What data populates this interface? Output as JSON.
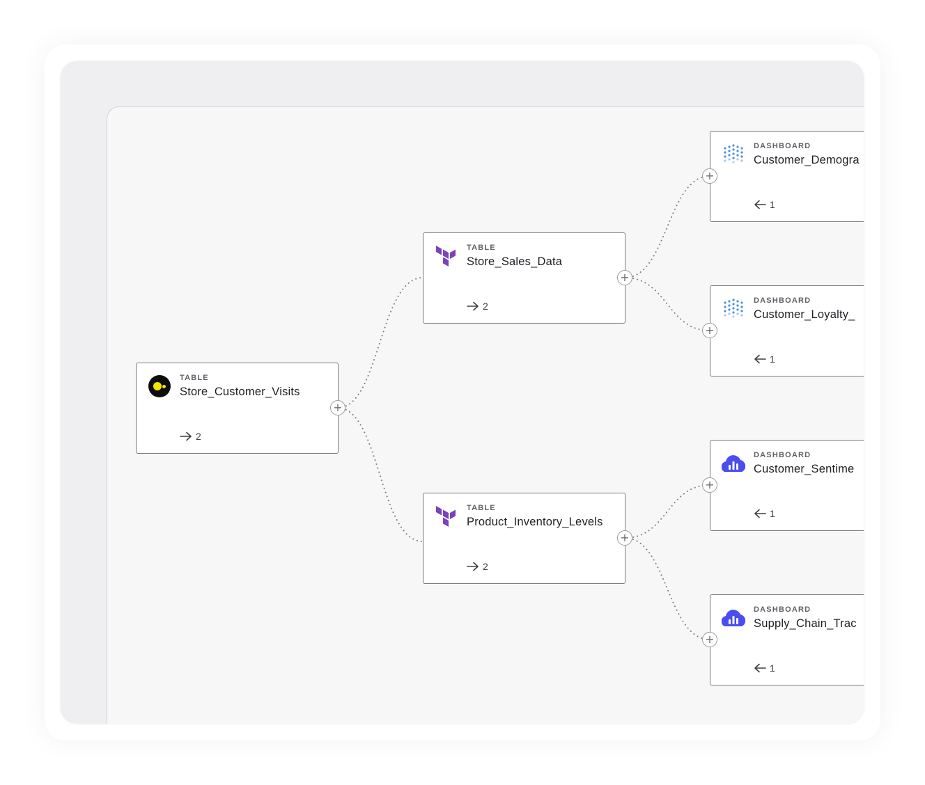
{
  "nodes": {
    "store_customer_visits": {
      "type": "TABLE",
      "name": "Store_Customer_Visits",
      "count": "2"
    },
    "store_sales_data": {
      "type": "TABLE",
      "name": "Store_Sales_Data",
      "count": "2"
    },
    "product_inventory_levels": {
      "type": "TABLE",
      "name": "Product_Inventory_Levels",
      "count": "2"
    },
    "customer_demographics": {
      "type": "DASHBOARD",
      "name": "Customer_Demogra",
      "count": "1"
    },
    "customer_loyalty": {
      "type": "DASHBOARD",
      "name": "Customer_Loyalty_",
      "count": "1"
    },
    "customer_sentiment": {
      "type": "DASHBOARD",
      "name": "Customer_Sentime",
      "count": "1"
    },
    "supply_chain": {
      "type": "DASHBOARD",
      "name": "Supply_Chain_Trac",
      "count": "1"
    }
  },
  "edges": [
    {
      "from": "store_customer_visits",
      "to": "store_sales_data"
    },
    {
      "from": "store_customer_visits",
      "to": "product_inventory_levels"
    },
    {
      "from": "store_sales_data",
      "to": "customer_demographics"
    },
    {
      "from": "store_sales_data",
      "to": "customer_loyalty"
    },
    {
      "from": "product_inventory_levels",
      "to": "customer_sentiment"
    },
    {
      "from": "product_inventory_levels",
      "to": "supply_chain"
    }
  ],
  "icons": {
    "expand": "plus-icon",
    "downstream": "arrow-right-icon",
    "upstream": "arrow-left-icon",
    "source_logo": "yellow-dot-logo-icon",
    "table_logo": "terraform-logo-icon",
    "dashboard_logo_dots": "dot-grid-logo-icon",
    "dashboard_logo_cloud": "cloud-bar-chart-logo-icon"
  },
  "colors": {
    "edge": "#7d7e85",
    "terraform_purple": "#7b42bc",
    "dot_grid_blue": "#4a90e2",
    "cloud_blue": "#4a4ef0",
    "source_yellow": "#f5e400"
  }
}
